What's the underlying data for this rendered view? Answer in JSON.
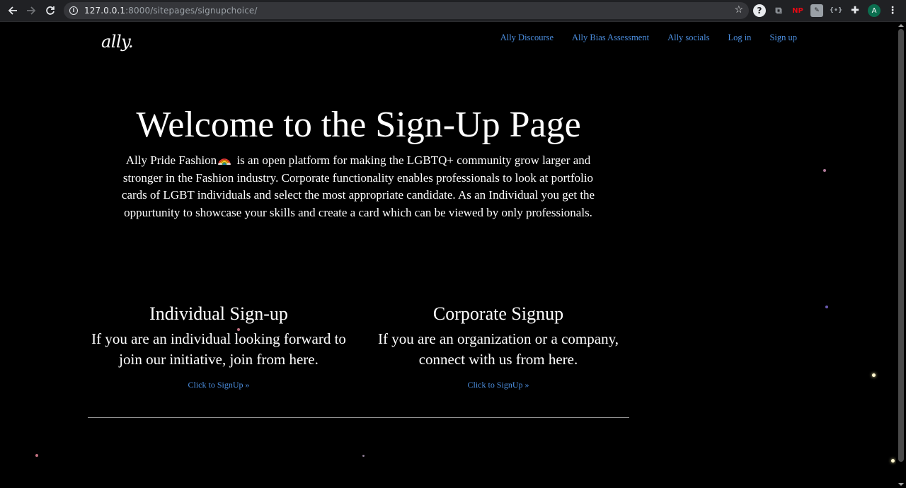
{
  "browser": {
    "url_host": "127.0.0.1",
    "url_rest": ":8000/sitepages/signupchoice/",
    "avatar_letter": "A",
    "ext_np_label": "NP"
  },
  "site": {
    "logo": "ally.",
    "nav": [
      {
        "label": "Ally Discourse"
      },
      {
        "label": "Ally Bias Assessment"
      },
      {
        "label": "Ally socials"
      },
      {
        "label": "Log in"
      },
      {
        "label": "Sign up"
      }
    ],
    "link_color": "#4c8fe0"
  },
  "hero": {
    "title": "Welcome to the Sign-Up Page",
    "text_before_emoji": "Ally Pride Fashion",
    "text_after_emoji": " is an open platform for making the LGBTQ+ community grow larger and stronger in the Fashion industry. Corporate functionality enables professionals to look at portfolio cards of LGBT individuals and select the most appropriate candidate. As an Individual you get the oppurtunity to showcase your skills and create a card which can be viewed by only professionals."
  },
  "individual": {
    "title": "Individual Sign-up",
    "text": "If you are an individual looking forward to join our initiative, join from here.",
    "link": "Click to SignUp »"
  },
  "corporate": {
    "title": "Corporate Signup",
    "text": "If you are an organization or a company, connect with us from here.",
    "link": "Click to SignUp »"
  }
}
